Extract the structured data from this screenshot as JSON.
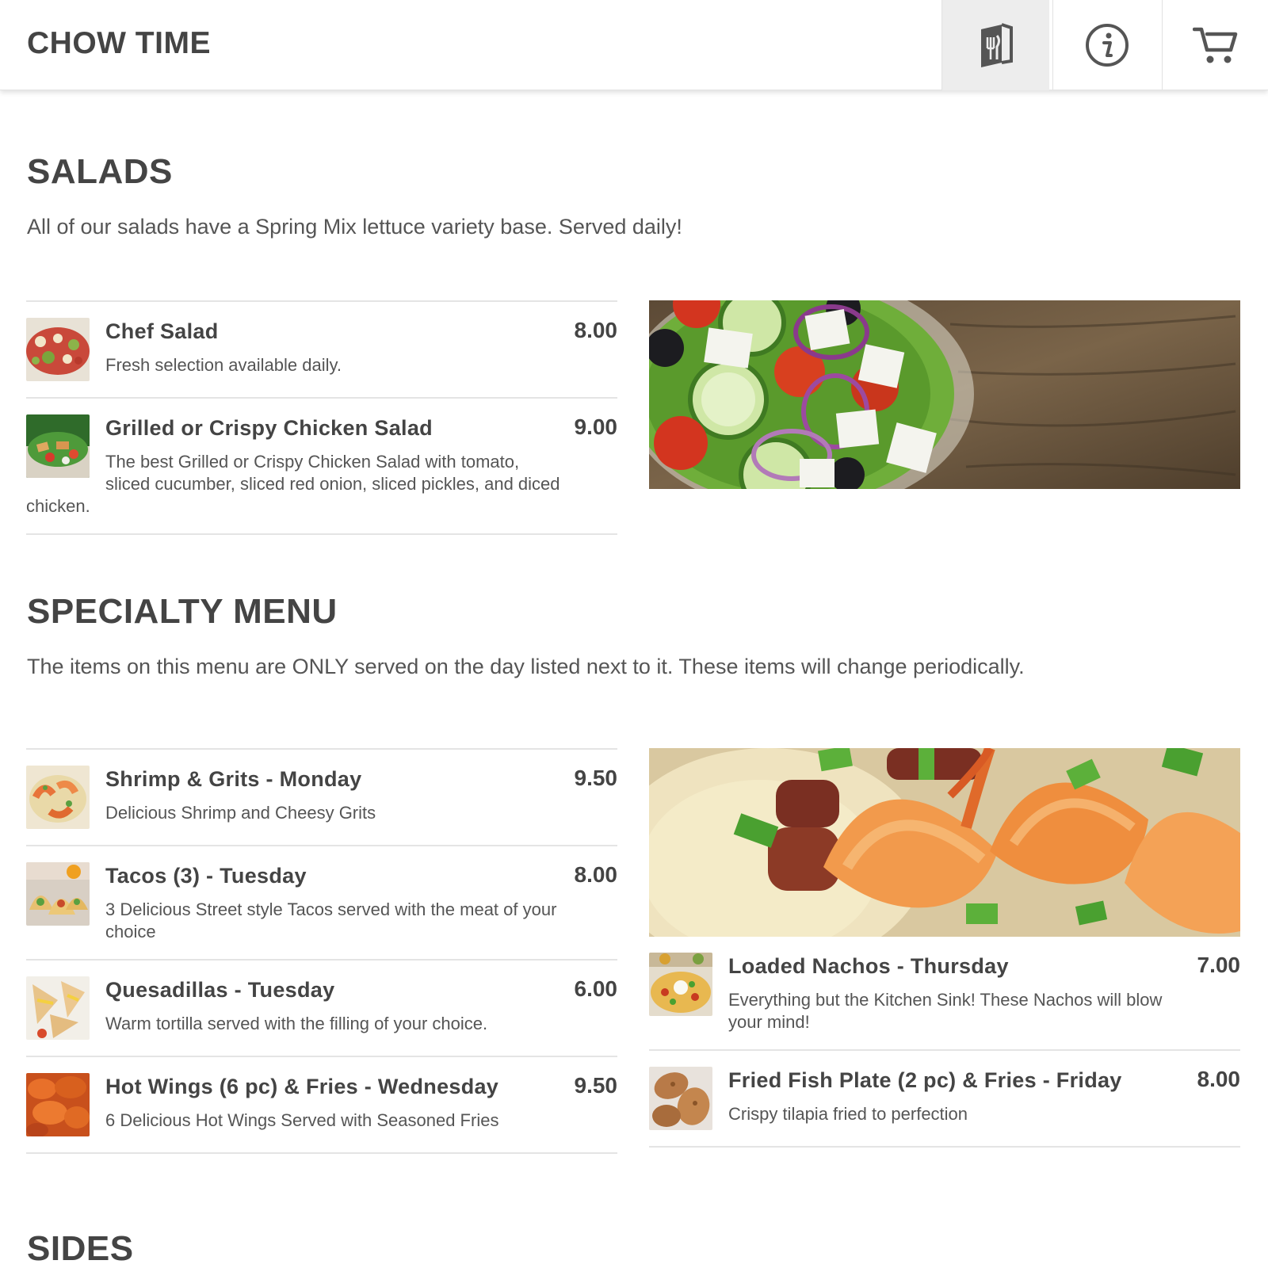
{
  "header": {
    "brand": "CHOW TIME",
    "icons": [
      "menu-book-icon",
      "info-icon",
      "cart-icon"
    ]
  },
  "sections": {
    "salads": {
      "title": "SALADS",
      "description": "All of our salads have a Spring Mix lettuce variety base. Served daily!",
      "items": [
        {
          "name": "Chef Salad",
          "price": "8.00",
          "description": "Fresh selection available daily."
        },
        {
          "name": "Grilled or Crispy Chicken Salad",
          "price": "9.00",
          "description": "The best Grilled or Crispy Chicken Salad with tomato, sliced cucumber, sliced red onion, sliced pickles, and diced chicken."
        }
      ]
    },
    "specialty": {
      "title": "SPECIALTY MENU",
      "description": "The items on this menu are ONLY served on the day listed next to it. These items will change periodically.",
      "items": [
        {
          "name": "Shrimp & Grits - Monday",
          "price": "9.50",
          "description": "Delicious Shrimp and Cheesy Grits"
        },
        {
          "name": "Tacos (3) - Tuesday",
          "price": "8.00",
          "description": "3 Delicious Street style Tacos served with the meat of your choice"
        },
        {
          "name": "Quesadillas - Tuesday",
          "price": "6.00",
          "description": "Warm tortilla served with the filling of your choice."
        },
        {
          "name": "Hot Wings (6 pc) & Fries - Wednesday",
          "price": "9.50",
          "description": "6 Delicious Hot Wings Served with Seasoned Fries"
        },
        {
          "name": "Loaded Nachos - Thursday",
          "price": "7.00",
          "description": "Everything but the Kitchen Sink! These Nachos will blow your mind!"
        },
        {
          "name": "Fried Fish Plate (2 pc) & Fries - Friday",
          "price": "8.00",
          "description": "Crispy tilapia fried to perfection"
        }
      ]
    },
    "sides": {
      "title": "SIDES"
    }
  }
}
